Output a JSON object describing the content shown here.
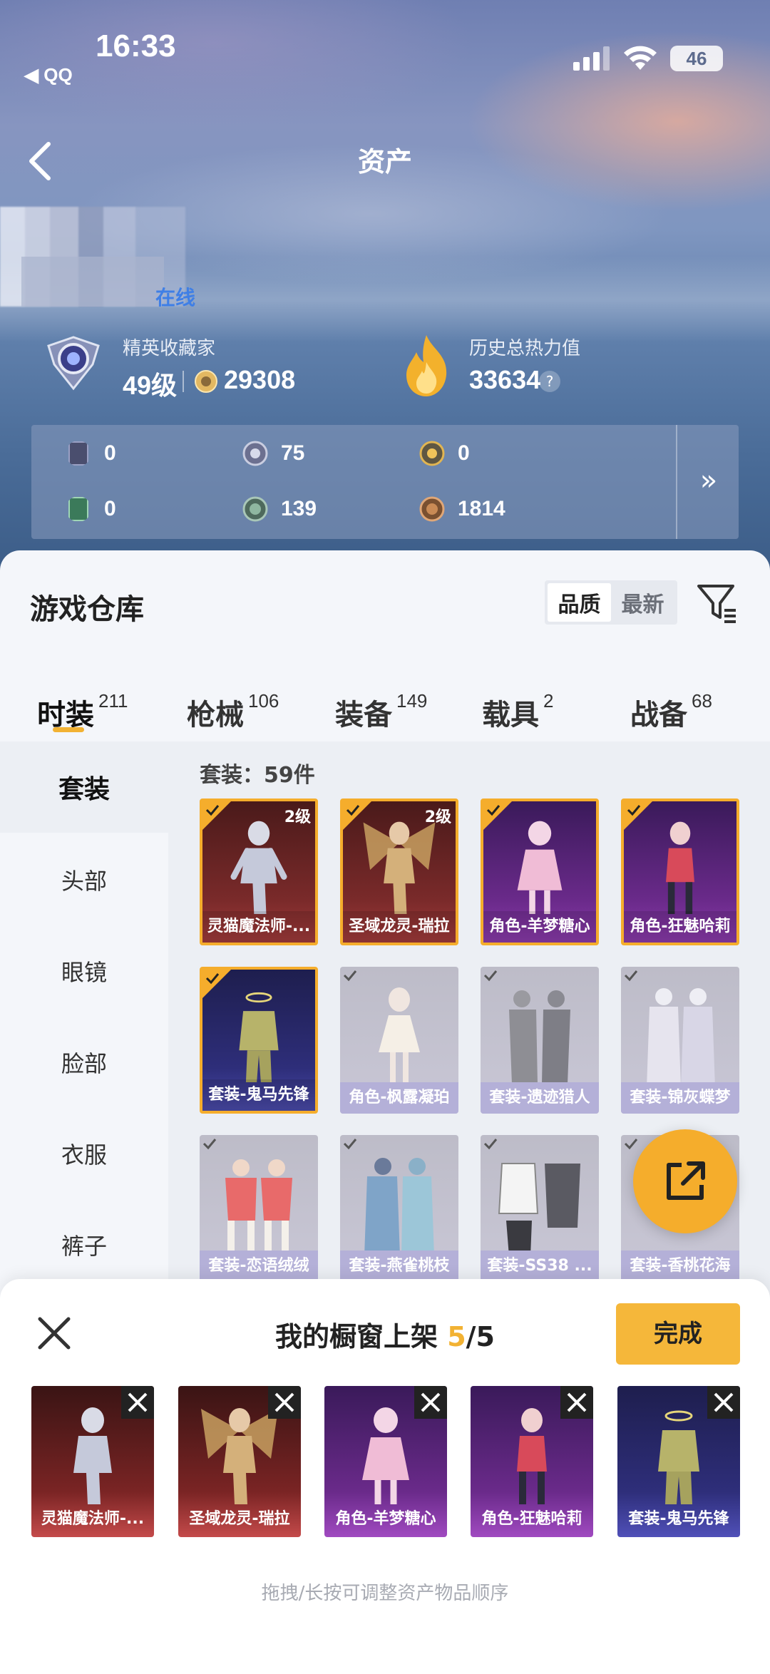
{
  "status_bar": {
    "time": "16:33",
    "back_app": "◀ QQ",
    "battery": "46"
  },
  "nav": {
    "title": "资产"
  },
  "profile": {
    "online": "在线",
    "rank_title": "精英收藏家",
    "rank_level": "49级",
    "coins": "29308",
    "heat_title": "历史总热力值",
    "heat_value": "33634",
    "help": "?"
  },
  "currencies": [
    {
      "icon": "card-icon",
      "value": "0"
    },
    {
      "icon": "silver-coin-icon",
      "value": "75"
    },
    {
      "icon": "gold-coin-icon",
      "value": "0"
    },
    {
      "icon": "green-card-icon",
      "value": "0"
    },
    {
      "icon": "green-orb-icon",
      "value": "139"
    },
    {
      "icon": "bronze-orb-icon",
      "value": "1814"
    }
  ],
  "currency_more": "»",
  "warehouse": {
    "title": "游戏仓库",
    "sort_options": [
      "品质",
      "最新"
    ],
    "tabs": [
      {
        "label": "时装",
        "count": "211"
      },
      {
        "label": "枪械",
        "count": "106"
      },
      {
        "label": "装备",
        "count": "149"
      },
      {
        "label": "载具",
        "count": "2"
      },
      {
        "label": "战备",
        "count": "68"
      }
    ],
    "categories": [
      "套装",
      "头部",
      "眼镜",
      "脸部",
      "衣服",
      "裤子"
    ],
    "grid_header": "套装：59件",
    "items": [
      {
        "name": "灵猫魔法师-...",
        "level": "2级",
        "selected": true
      },
      {
        "name": "圣域龙灵-瑞拉",
        "level": "2级",
        "selected": true
      },
      {
        "name": "角色-羊梦糖心",
        "level": "",
        "selected": true
      },
      {
        "name": "角色-狂魅哈莉",
        "level": "",
        "selected": true
      },
      {
        "name": "套装-鬼马先锋",
        "level": "",
        "selected": true
      },
      {
        "name": "角色-枫露凝珀",
        "level": "",
        "selected": false
      },
      {
        "name": "套装-遗迹猎人",
        "level": "",
        "selected": false
      },
      {
        "name": "套装-锦灰蝶梦",
        "level": "",
        "selected": false
      },
      {
        "name": "套装-恋语绒绒",
        "level": "",
        "selected": false
      },
      {
        "name": "套装-燕雀桃枝",
        "level": "",
        "selected": false
      },
      {
        "name": "套装-SS38 ...",
        "level": "",
        "selected": false
      },
      {
        "name": "套装-香桃花海",
        "level": "",
        "selected": false
      }
    ]
  },
  "showcase": {
    "title_prefix": "我的橱窗上架 ",
    "count_current": "5",
    "count_total": "/5",
    "done": "完成",
    "slots": [
      "灵猫魔法师-...",
      "圣域龙灵-瑞拉",
      "角色-羊梦糖心",
      "角色-狂魅哈莉",
      "套装-鬼马先锋"
    ],
    "hint": "拖拽/长按可调整资产物品顺序"
  },
  "colors": {
    "accent": "#f5ad2c",
    "online": "#3f7fe6",
    "panel_bg": "#f4f6fa"
  }
}
